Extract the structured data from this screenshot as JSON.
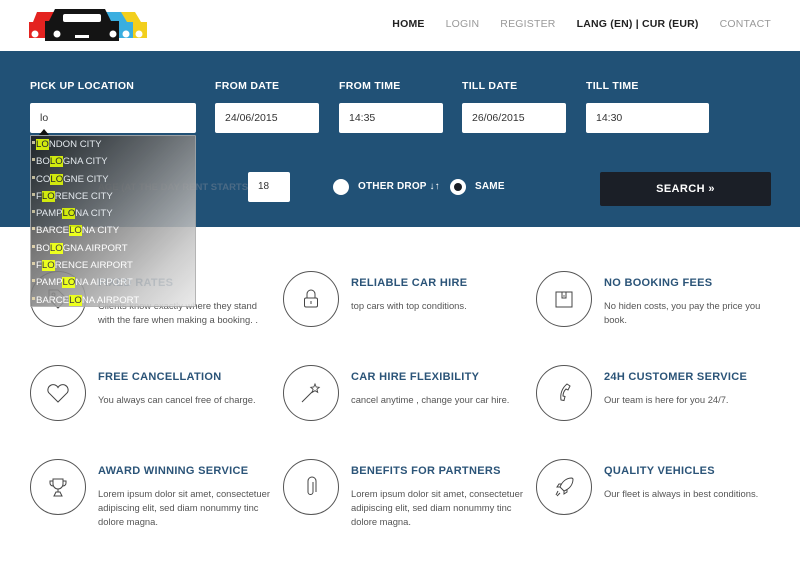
{
  "header": {
    "logo_alt": "car rental logo",
    "nav": [
      {
        "label": "HOME",
        "active": true
      },
      {
        "label": "LOGIN",
        "active": false
      },
      {
        "label": "REGISTER",
        "active": false
      },
      {
        "label": "LANG (EN) | CUR (EUR)",
        "active": false
      },
      {
        "label": "CONTACT",
        "active": false
      }
    ]
  },
  "search": {
    "pickup_label": "PICK UP LOCATION",
    "pickup_value": "lo",
    "from_date_label": "FROM DATE",
    "from_date_value": "24/06/2015",
    "from_time_label": "FROM TIME",
    "from_time_value": "14:35",
    "till_date_label": "TILL DATE",
    "till_date_value": "26/06/2015",
    "till_time_label": "TILL TIME",
    "till_time_value": "14:30",
    "age_label_visible": "AGE (AT THE DAY RENT STARTS)?",
    "age_value": "18",
    "other_drop_label": "OTHER DROP ↓↑",
    "same_label": "SAME",
    "selected_drop": "same",
    "search_button": "SEARCH »"
  },
  "autocomplete": {
    "query": "LO",
    "items": [
      {
        "pre": "",
        "hl": "LO",
        "post": "NDON CITY"
      },
      {
        "pre": "BO",
        "hl": "LO",
        "post": "GNA CITY"
      },
      {
        "pre": "CO",
        "hl": "LO",
        "post": "GNE CITY"
      },
      {
        "pre": "F",
        "hl": "LO",
        "post": "RENCE CITY"
      },
      {
        "pre": "PAMP",
        "hl": "LO",
        "post": "NA CITY"
      },
      {
        "pre": "BARCE",
        "hl": "LO",
        "post": "NA CITY"
      },
      {
        "pre": "BO",
        "hl": "LO",
        "post": "GNA AIRPORT"
      },
      {
        "pre": "F",
        "hl": "LO",
        "post": "RENCE AIRPORT"
      },
      {
        "pre": "PAMP",
        "hl": "LO",
        "post": "NA AIRPORT"
      },
      {
        "pre": "BARCE",
        "hl": "LO",
        "post": "NA AIRPORT"
      }
    ]
  },
  "features": [
    {
      "icon": "tag-icon",
      "title": "FIXED RATES",
      "text": "Clients know exactly where they stand with the fare when making a booking. ."
    },
    {
      "icon": "lock-icon",
      "title": "RELIABLE CAR HIRE",
      "text": "top cars with top conditions."
    },
    {
      "icon": "wallet-icon",
      "title": "NO BOOKING FEES",
      "text": "No hiden costs, you pay the price you book."
    },
    {
      "icon": "heart-icon",
      "title": "FREE CANCELLATION",
      "text": "You always can cancel free of charge."
    },
    {
      "icon": "magic-wand-icon",
      "title": "CAR HIRE FLEXIBILITY",
      "text": "cancel anytime , change your car hire."
    },
    {
      "icon": "phone-icon",
      "title": "24H CUSTOMER SERVICE",
      "text": "Our team is here for you 24/7."
    },
    {
      "icon": "trophy-icon",
      "title": "AWARD WINNING SERVICE",
      "text": "Lorem ipsum dolor sit amet, consectetuer adipiscing elit, sed diam nonummy tinc dolore magna."
    },
    {
      "icon": "paperclip-icon",
      "title": "BENEFITS FOR PARTNERS",
      "text": "Lorem ipsum dolor sit amet, consectetuer adipiscing elit, sed diam nonummy tinc dolore magna."
    },
    {
      "icon": "rocket-icon",
      "title": "QUALITY VEHICLES",
      "text": "Our fleet is always in best conditions."
    }
  ],
  "colors": {
    "band": "#215176",
    "heading": "#2b5478",
    "search_button": "#1b1f27",
    "highlight": "#eaff00"
  }
}
